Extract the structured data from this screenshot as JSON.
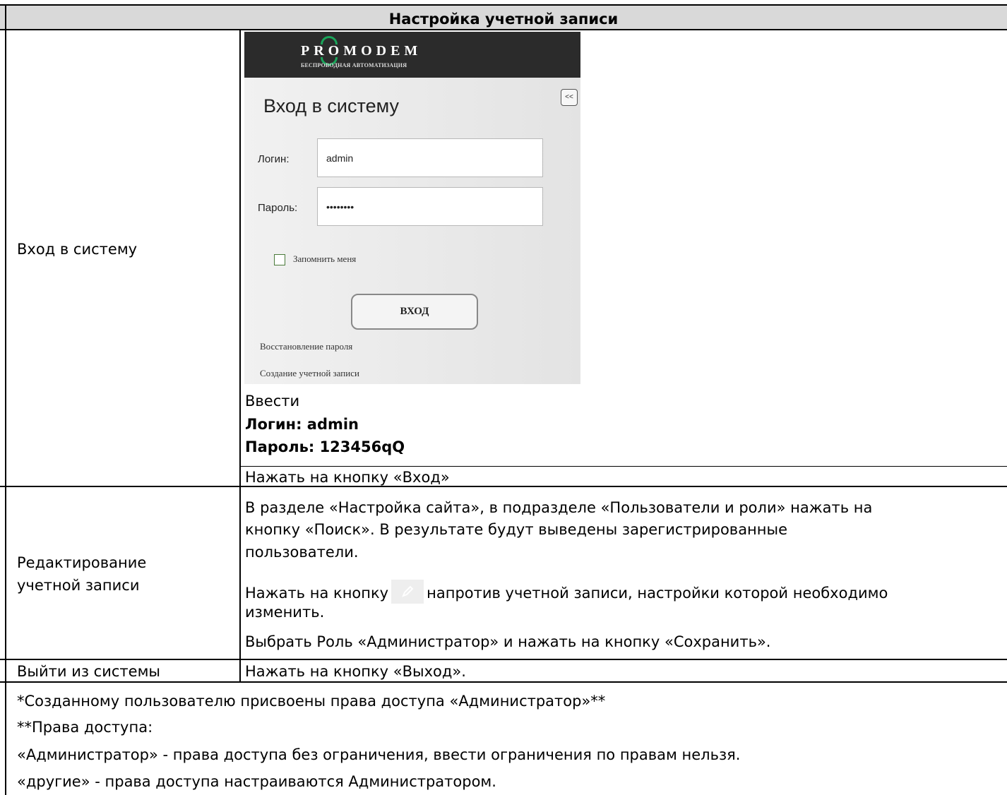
{
  "title": "Настройка учетной записи",
  "rows": [
    {
      "label": "Вход в систему",
      "screenshot": {
        "brand": "PROMODEM",
        "brand_sub": "БЕСПРОВОДНАЯ АВТОМАТИЗАЦИЯ",
        "collapse": "<<",
        "login_title": "Вход в систему",
        "login_label": "Логин:",
        "login_value": "admin",
        "password_label": "Пароль:",
        "password_value": "••••••••",
        "remember_label": "Запомнить меня",
        "button_label": "ВХОД",
        "recover_link": "Восстановление пароля",
        "create_link": "Создание учетной записи"
      },
      "text_enter": "Ввести",
      "text_login": "Логин: admin",
      "text_password": "Пароль: 123456qQ",
      "text_press": "Нажать на кнопку «Вход»"
    },
    {
      "label_line1": "Редактирование",
      "label_line2": "учетной записи",
      "p1_line1": "В разделе «Настройка сайта», в подразделе «Пользователи и роли» нажать на",
      "p1_line2": "кнопку «Поиск». В результате будут выведены зарегистрированные",
      "p1_line3": "пользователи.",
      "p2_before": "Нажать на кнопку",
      "p2_after": "напротив учетной записи, настройки которой необходимо",
      "p2_line2": "изменить.",
      "p3": "Выбрать Роль «Администратор» и нажать на кнопку «Сохранить»."
    },
    {
      "label": "Выйти из системы",
      "text": "Нажать на кнопку «Выход»."
    }
  ],
  "footnotes": [
    "*Созданному пользователю присвоены права доступа «Администратор»**",
    "**Права доступа:",
    "«Администратор» - права доступа без ограничения, ввести ограничения по правам нельзя.",
    "«другие» - права доступа настраиваются Администратором."
  ]
}
